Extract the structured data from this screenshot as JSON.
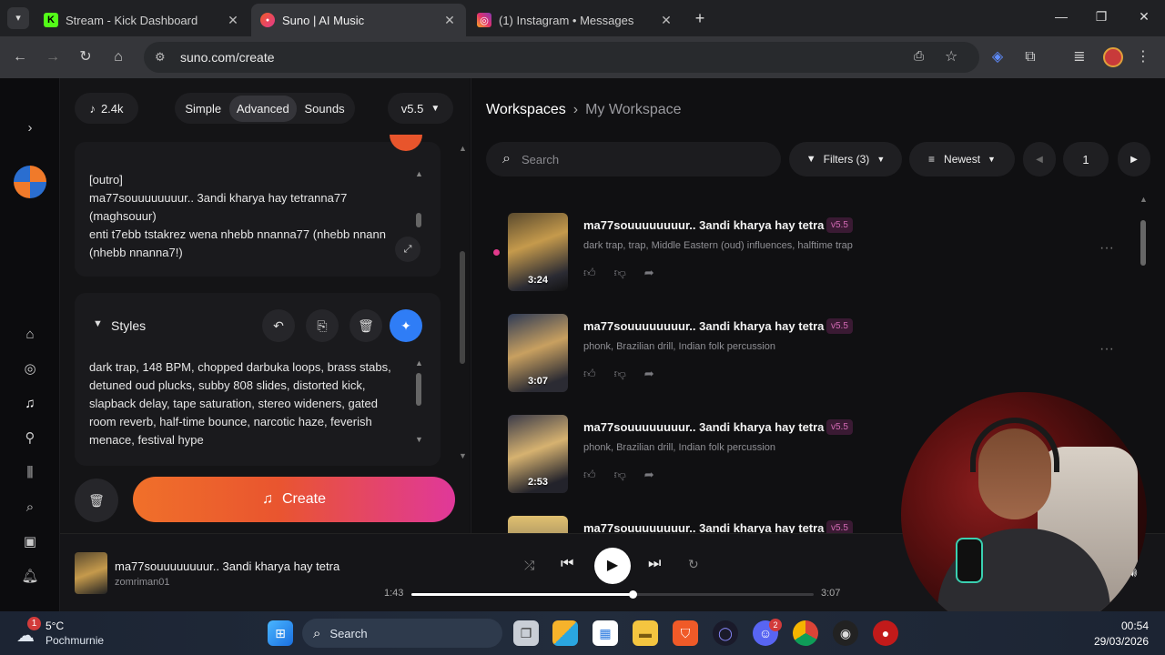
{
  "browser": {
    "tabs": [
      {
        "title": "Stream - Kick Dashboard",
        "icon": "kick-logo-icon",
        "active": false
      },
      {
        "title": "Suno | AI Music",
        "icon": "suno-logo-icon",
        "active": true
      },
      {
        "title": "(1) Instagram • Messages",
        "icon": "instagram-logo-icon",
        "active": false
      }
    ],
    "url": "suno.com/create"
  },
  "topbar": {
    "credits": "2.4k",
    "modes": [
      "Simple",
      "Advanced",
      "Sounds"
    ],
    "selected_mode": "Advanced",
    "version": "v5.5"
  },
  "lyrics": {
    "text": "[outro]\nma77souuuuuuuur.. 3andi kharya hay tetranna77\n(maghsouur)\nenti t7ebb tstakrez wena nhebb nnanna77 (nhebb nnann\n(nhebb nnanna7!)"
  },
  "styles": {
    "label": "Styles",
    "text": "dark trap, 148 BPM, chopped darbuka loops, brass stabs, detuned oud plucks, subby 808 slides, distorted kick, slapback delay, tape saturation, stereo wideners, gated room reverb, half-time bounce, narcotic haze, feverish menace, festival hype"
  },
  "create_button": "Create",
  "workspace": {
    "breadcrumb_root": "Workspaces",
    "breadcrumb_current": "My Workspace",
    "search_placeholder": "Search",
    "filters": "Filters (3)",
    "sort": "Newest",
    "page": "1"
  },
  "songs": [
    {
      "title": "ma77souuuuuuuur.. 3andi kharya hay tetra",
      "version": "v5.5",
      "tags": "dark trap, trap, Middle Eastern (oud) influences, halftime trap",
      "duration": "3:24"
    },
    {
      "title": "ma77souuuuuuuur.. 3andi kharya hay tetra",
      "version": "v5.5",
      "tags": "phonk, Brazilian drill, Indian folk percussion",
      "duration": "3:07"
    },
    {
      "title": "ma77souuuuuuuur.. 3andi kharya hay tetra",
      "version": "v5.5",
      "tags": "phonk, Brazilian drill, Indian folk percussion",
      "duration": "2:53"
    },
    {
      "title": "ma77souuuuuuuur.. 3andi kharya hay tetra",
      "version": "v5.5",
      "tags": "",
      "duration": ""
    }
  ],
  "player": {
    "title": "ma77souuuuuuuur.. 3andi kharya hay tetra",
    "artist": "zomriman01",
    "elapsed": "1:43",
    "total": "3:07",
    "progress": 0.55
  },
  "taskbar": {
    "weather_temp": "5°C",
    "weather_desc": "Pochmurnie",
    "weather_badge": "1",
    "search": "Search",
    "time": "00:54",
    "date": "29/03/2026",
    "discord_badge": "2"
  },
  "colors": {
    "accent_blue": "#2f7df6",
    "create_gradient_start": "#f0602a",
    "create_gradient_end": "#e0389a",
    "version_badge": "#d36ab4"
  }
}
